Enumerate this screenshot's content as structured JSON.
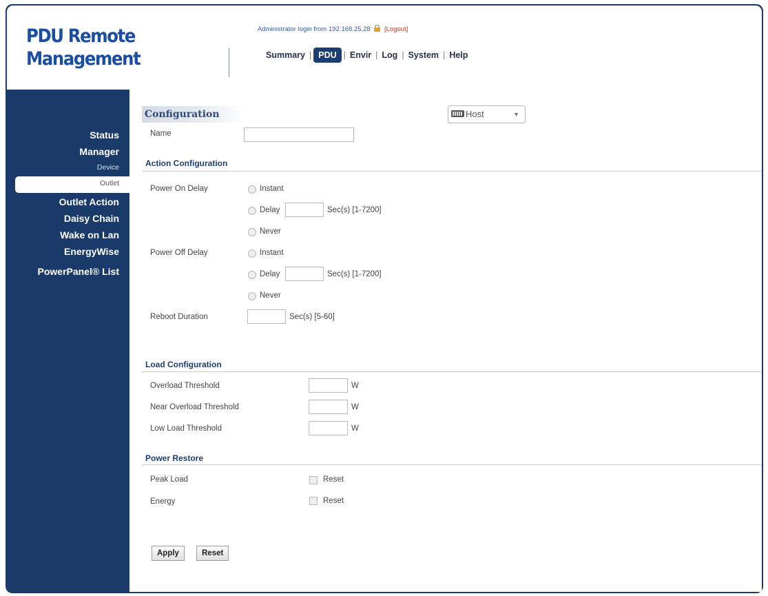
{
  "brand": {
    "line1": "PDU Remote",
    "line2": "Management"
  },
  "login": {
    "text": "Administrator login from 192.168.25.28",
    "logout": "[Logout]"
  },
  "nav": [
    "Summary",
    "PDU",
    "Envir",
    "Log",
    "System",
    "Help"
  ],
  "nav_active": "PDU",
  "sidebar": {
    "status": "Status",
    "manager": "Manager",
    "device": "Device",
    "outlet": "Outlet",
    "outlet_action": "Outlet Action",
    "daisy_chain": "Daisy Chain",
    "wake_on_lan": "Wake on Lan",
    "energywise": "EnergyWise",
    "powerpanel_list": "PowerPanel® List"
  },
  "config": {
    "title": "Configuration",
    "host_select": "Host",
    "name_label": "Name",
    "name_value": ""
  },
  "action": {
    "title": "Action Configuration",
    "power_on_delay": "Power On Delay",
    "power_off_delay": "Power Off Delay",
    "reboot_duration": "Reboot Duration",
    "opt_instant": "Instant",
    "opt_delay": "Delay",
    "opt_never": "Never",
    "delay_range": "Sec(s) [1-7200]",
    "reboot_range": "Sec(s) [5-60]",
    "on_delay_value": "",
    "off_delay_value": "",
    "reboot_value": ""
  },
  "load": {
    "title": "Load Configuration",
    "overload": "Overload Threshold",
    "near_overload": "Near Overload Threshold",
    "low_load": "Low Load Threshold",
    "unit": "W",
    "overload_value": "",
    "near_value": "",
    "low_value": ""
  },
  "restore": {
    "title": "Power Restore",
    "peak_load": "Peak Load",
    "energy": "Energy",
    "reset": "Reset"
  },
  "buttons": {
    "apply": "Apply",
    "reset": "Reset"
  },
  "colors": {
    "navy": "#1a3a6a",
    "brand_blue": "#1a4ea0",
    "active_tab": "#1d3e72",
    "logout": "#c0392b"
  }
}
